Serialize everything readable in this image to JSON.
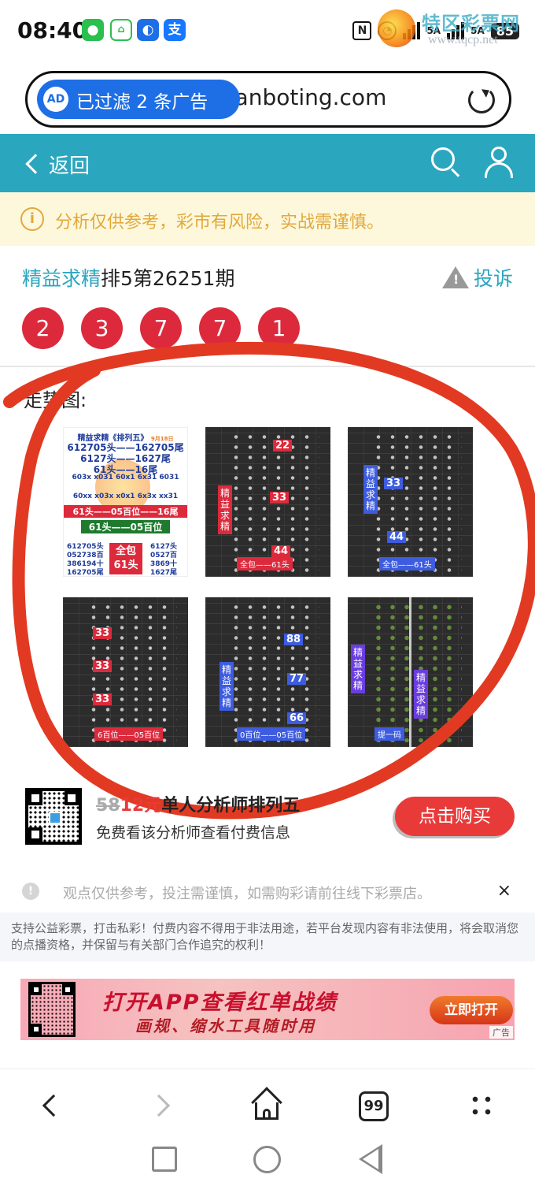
{
  "status_bar": {
    "time": "08:40",
    "app_icons": [
      "wechat-icon",
      "home-icon",
      "bulb-icon",
      "alipay-icon"
    ],
    "alipay_glyph": "支",
    "signal_labels": [
      "5A",
      "5A"
    ],
    "battery": "85"
  },
  "watermark": {
    "title": "特区彩票网",
    "url": "www.tqcp.net"
  },
  "url_bar": {
    "ad_badge": "AD",
    "ad_filter": "已过滤 2 条广告",
    "url": "dianboting.com"
  },
  "header": {
    "back_label": "返回"
  },
  "notice": {
    "icon": "i",
    "text": "分析仅供参考，彩市有风险，实战需谨慎。"
  },
  "article": {
    "brand": "精益求精",
    "issue": "排5第26251期",
    "complain_label": "投诉",
    "balls": [
      "2",
      "3",
      "7",
      "7",
      "1"
    ],
    "trend_label": "走势图:"
  },
  "thumbnails": {
    "flyer": {
      "head": "精益求精《排列五》",
      "head_date": "9月18日",
      "lines": [
        "612705头——162705尾",
        "6127头——1627尾",
        "61头——16尾"
      ],
      "row1": "603x x031 60x1 6x31 6031",
      "row2": "60xx x03x x0x1 6x3x xx31",
      "red_bar": "61头——05百位——16尾",
      "green_bar": "61头——05百位",
      "left_col": [
        "612705头",
        "052738百",
        "386194十",
        "162705尾"
      ],
      "box": [
        "全包",
        "61头"
      ],
      "right_col": [
        "6127头",
        "0527百",
        "3869十",
        "1627尾"
      ]
    },
    "chart_tags": {
      "t2_side": "精益求精",
      "t2_nums": [
        "22",
        "33",
        "44"
      ],
      "t2_bottom": "全包——61头",
      "t3_side": "精益求精",
      "t3_nums": [
        "33",
        "44"
      ],
      "t3_bottom": "全包——61头",
      "t4_nums": [
        "33",
        "33",
        "33"
      ],
      "t4_bottom": "6百位——05百位",
      "t5_side": "精益求精",
      "t5_nums": [
        "88",
        "77",
        "66"
      ],
      "t5_bottom": "0百位——05百位",
      "t6_side_a": "精益求精",
      "t6_side_b": "精益求精",
      "t6_bottom": "提一码"
    }
  },
  "promo": {
    "price_old": "58",
    "price_new": "12元",
    "title_rest": "单人分析师排列五",
    "subtitle": "免费看该分析师查看付费信息",
    "buy_button": "点击购买"
  },
  "disclaimer": {
    "icon": "!",
    "text": "观点仅供参考，投注需谨慎，如需购彩请前往线下彩票店。",
    "close": "×"
  },
  "legal": "支持公益彩票，打击私彩！付费内容不得用于非法用途，若平台发现内容有非法使用，将会取消您的点播资格，并保留与有关部门合作追究的权利！",
  "banner": {
    "title": "打开APP查看红单战绩",
    "subtitle": "画规、缩水工具随时用",
    "button": "立即打开",
    "ad_label": "广告"
  },
  "bottom_nav": {
    "tabs_count": "99"
  },
  "colors": {
    "teal": "#2ba6bf",
    "red": "#dc2a3c",
    "notice_text": "#e2a83b",
    "notice_bg": "#fdf8dc",
    "buy": "#e93a3a"
  }
}
